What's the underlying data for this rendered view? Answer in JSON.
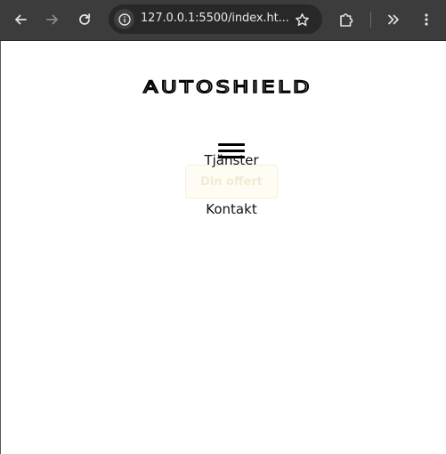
{
  "browser": {
    "url": "127.0.0.1:5500/index.ht...",
    "icons": [
      "back-arrow-icon",
      "forward-arrow-icon",
      "reload-icon",
      "site-info-icon",
      "bookmark-star-icon",
      "extensions-icon",
      "chevron-double-right-icon",
      "kebab-menu-icon"
    ]
  },
  "site": {
    "logo_text": "AUTOSHIELD",
    "menu_icon": "hamburger-menu-icon",
    "offer_button_label": "Din offert",
    "nav": {
      "services": "Tjänster",
      "contact": "Kontakt"
    }
  }
}
